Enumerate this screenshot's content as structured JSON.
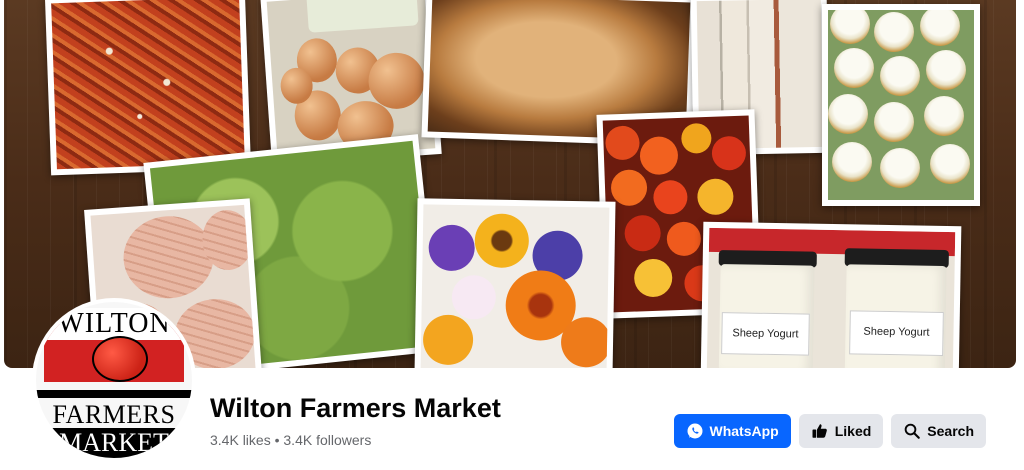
{
  "page": {
    "name": "Wilton Farmers Market",
    "likes": "3.4K likes",
    "separator": "•",
    "followers": "3.4K followers"
  },
  "logo": {
    "line1": "WILTON",
    "line2": "FARMERS",
    "line3": "MARKET"
  },
  "cover_labels": {
    "yogurt_left": "Sheep Yogurt",
    "yogurt_right": "Sheep Yogurt"
  },
  "actions": {
    "whatsapp": "WhatsApp",
    "liked": "Liked",
    "search": "Search"
  },
  "colors": {
    "primary": "#0866ff",
    "secondary_bg": "#e4e6eb",
    "text": "#050505",
    "muted": "#65676b"
  },
  "icons": {
    "whatsapp": "whatsapp-icon",
    "liked": "thumbs-up-icon",
    "search": "search-icon"
  }
}
